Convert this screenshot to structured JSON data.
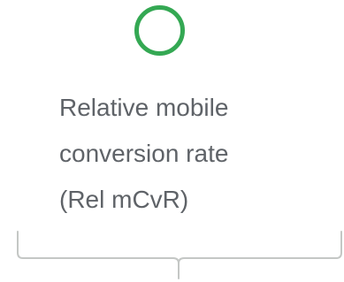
{
  "metric": {
    "icon": "circle-outline-icon",
    "accent_color": "#34a853",
    "text_color": "#5f6368",
    "bracket_color": "#c4c7c5",
    "label_lines": [
      "Relative mobile",
      "conversion rate",
      "(Rel mCvR)"
    ]
  }
}
